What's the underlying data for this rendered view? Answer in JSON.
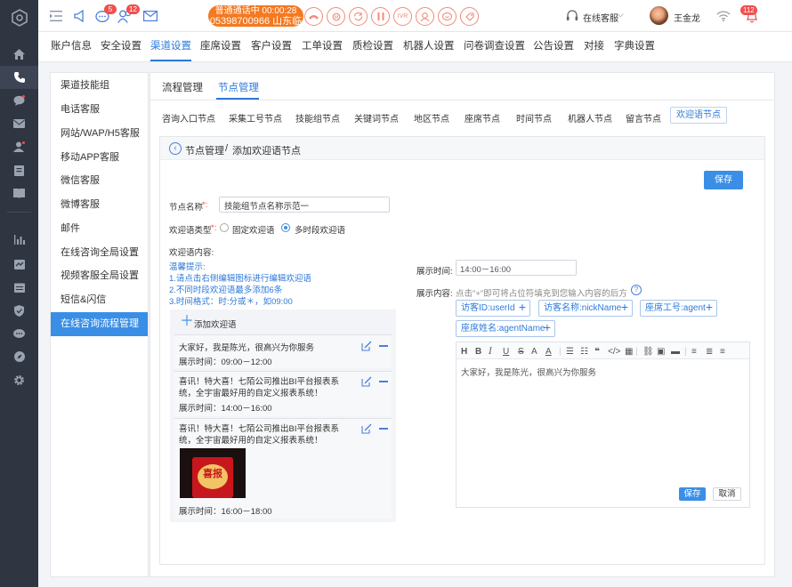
{
  "topbar": {
    "badge_chat": "5",
    "badge_users": "12",
    "call_line1": "普通通话中  00:00:28",
    "call_line2": "05398700966 山东临沂",
    "ctrl_ivr": "IVR",
    "status": "在线客服",
    "user_name": "王金龙",
    "badge_bell": "112"
  },
  "nav": [
    "账户信息",
    "安全设置",
    "渠道设置",
    "座席设置",
    "客户设置",
    "工单设置",
    "质检设置",
    "机器人设置",
    "问卷调查设置",
    "公告设置",
    "对接",
    "字典设置"
  ],
  "left_menu": [
    "渠道技能组",
    "电话客服",
    "网站/WAP/H5客服",
    "移动APP客服",
    "微信客服",
    "微博客服",
    "邮件",
    "在线咨询全局设置",
    "视频客服全局设置",
    "短信&闪信",
    "在线咨询流程管理"
  ],
  "tabs": {
    "flow": "流程管理",
    "node": "节点管理"
  },
  "node_tabs": [
    "咨询入口节点",
    "采集工号节点",
    "技能组节点",
    "关键词节点",
    "地区节点",
    "座席节点",
    "时间节点",
    "机器人节点",
    "留言节点",
    "欢迎语节点"
  ],
  "breadcrumb": {
    "parent": "节点管理",
    "sep": "/",
    "current": "添加欢迎语节点"
  },
  "save": "保存",
  "form": {
    "name_label": "节点名称",
    "name_value": "技能组节点名称示范一",
    "type_label": "欢迎语类型",
    "type_fixed": "固定欢迎语",
    "type_multi": "多时段欢迎语",
    "content_label": "欢迎语内容:",
    "tips_title": "温馨提示:",
    "tip1": "1.请点击右侧编辑图标进行编辑欢迎语",
    "tip2": "2.不同时段欢迎语最多添加6条",
    "tip3": "3.时间格式：时:分或＊，如09:00",
    "add_label": "添加欢迎语"
  },
  "welcome_items": [
    {
      "text": "大家好，我是陈光，很高兴为你服务",
      "time": "展示时间：09:00－12:00"
    },
    {
      "text": "喜讯！特大喜！七陌公司推出BI平台报表系统，全宇宙最好用的自定义报表系统！",
      "time": "展示时间：14:00－16:00"
    },
    {
      "text": "喜讯！特大喜！七陌公司推出BI平台报表系统，全宇宙最好用的自定义报表系统！",
      "time": "展示时间：16:00－18:00",
      "image_text": "喜报"
    }
  ],
  "editor": {
    "time_label": "展示时间:",
    "time_value": "14:00－16:00",
    "content_label": "展示内容:",
    "hint": "点击\"+\"即可将占位符填充到您输入内容的后方",
    "tags": [
      "访客ID:userId",
      "访客名称:nickName",
      "座席工号:agent",
      "座席姓名:agentName"
    ],
    "body": "大家好，我是陈光，很高兴为你服务",
    "save": "保存",
    "cancel": "取消"
  }
}
